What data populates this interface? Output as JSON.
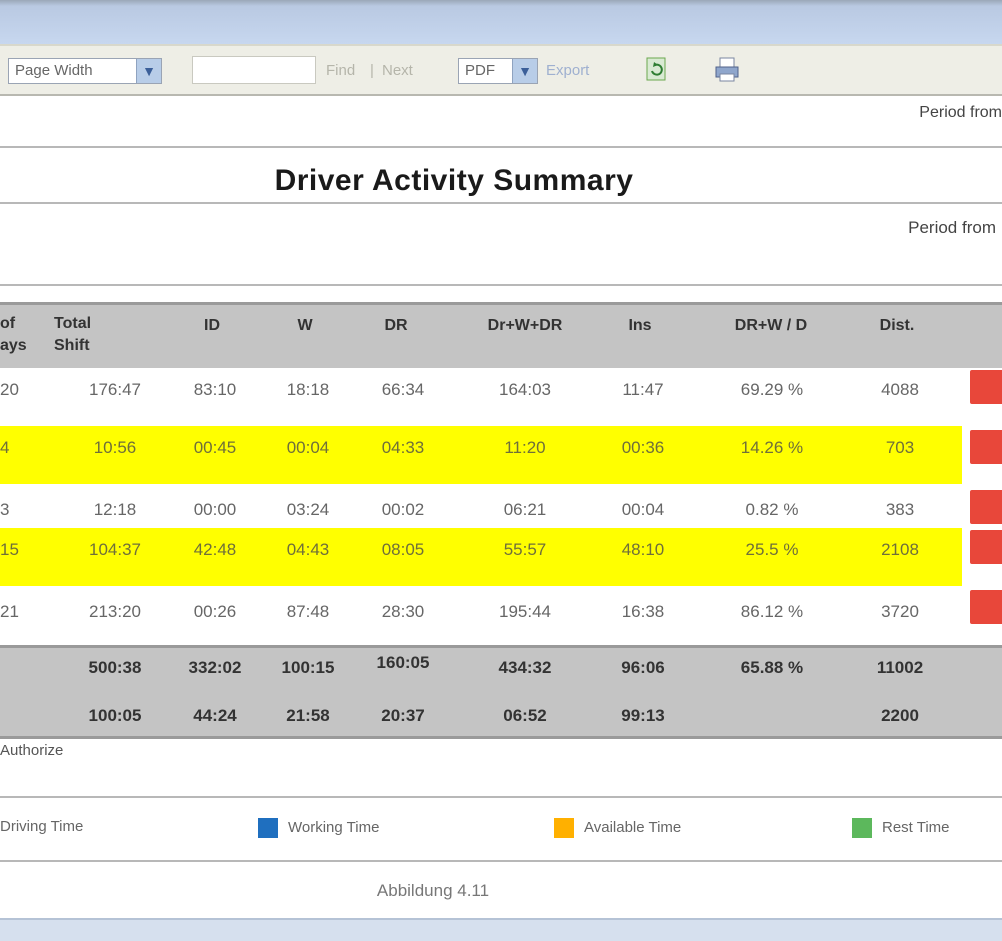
{
  "toolbar": {
    "zoom_select": "Page Width",
    "find_value": "",
    "find_label": "Find",
    "separator": "|",
    "next_label": "Next",
    "format_select": "PDF",
    "export_label": "Export",
    "icons": [
      "refresh-icon",
      "print-icon"
    ]
  },
  "report": {
    "period_top": "Period from",
    "title": "Driver Activity Summary",
    "period_mid": "Period from"
  },
  "table": {
    "headers": [
      "of\nays",
      "Total\nShift",
      "ID",
      "W",
      "DR",
      "Dr+W+DR",
      "Ins",
      "DR+W / D",
      "Dist."
    ],
    "rows": [
      {
        "highlight": false,
        "cells": [
          "20",
          "176:47",
          "83:10",
          "18:18",
          "66:34",
          "164:03",
          "11:47",
          "69.29 %",
          "4088"
        ]
      },
      {
        "highlight": true,
        "cells": [
          "4",
          "10:56",
          "00:45",
          "00:04",
          "04:33",
          "11:20",
          "00:36",
          "14.26 %",
          "703"
        ]
      },
      {
        "highlight": false,
        "cells": [
          "3",
          "12:18",
          "00:00",
          "03:24",
          "00:02",
          "06:21",
          "00:04",
          "0.82 %",
          "383"
        ]
      },
      {
        "highlight": true,
        "cells": [
          "15",
          "104:37",
          "42:48",
          "04:43",
          "08:05",
          "55:57",
          "48:10",
          "25.5 %",
          "2108"
        ]
      },
      {
        "highlight": false,
        "cells": [
          "21",
          "213:20",
          "00:26",
          "87:48",
          "28:30",
          "195:44",
          "16:38",
          "86.12 %",
          "3720"
        ]
      }
    ],
    "totals": [
      [
        "500:38",
        "332:02",
        "100:15",
        "160:05",
        "434:32",
        "96:06",
        "65.88 %",
        "11002"
      ],
      [
        "100:05",
        "44:24",
        "21:58",
        "20:37",
        "06:52",
        "99:13",
        "",
        "2200"
      ]
    ]
  },
  "footnote": "Authorize",
  "legend": [
    {
      "label": "Driving Time",
      "color": ""
    },
    {
      "label": "Working Time",
      "color": "#1f6fbf"
    },
    {
      "label": "Available Time",
      "color": "#ffb000"
    },
    {
      "label": "Rest Time",
      "color": "#5cb85c"
    }
  ],
  "page_footer": "Abbildung 4.11"
}
